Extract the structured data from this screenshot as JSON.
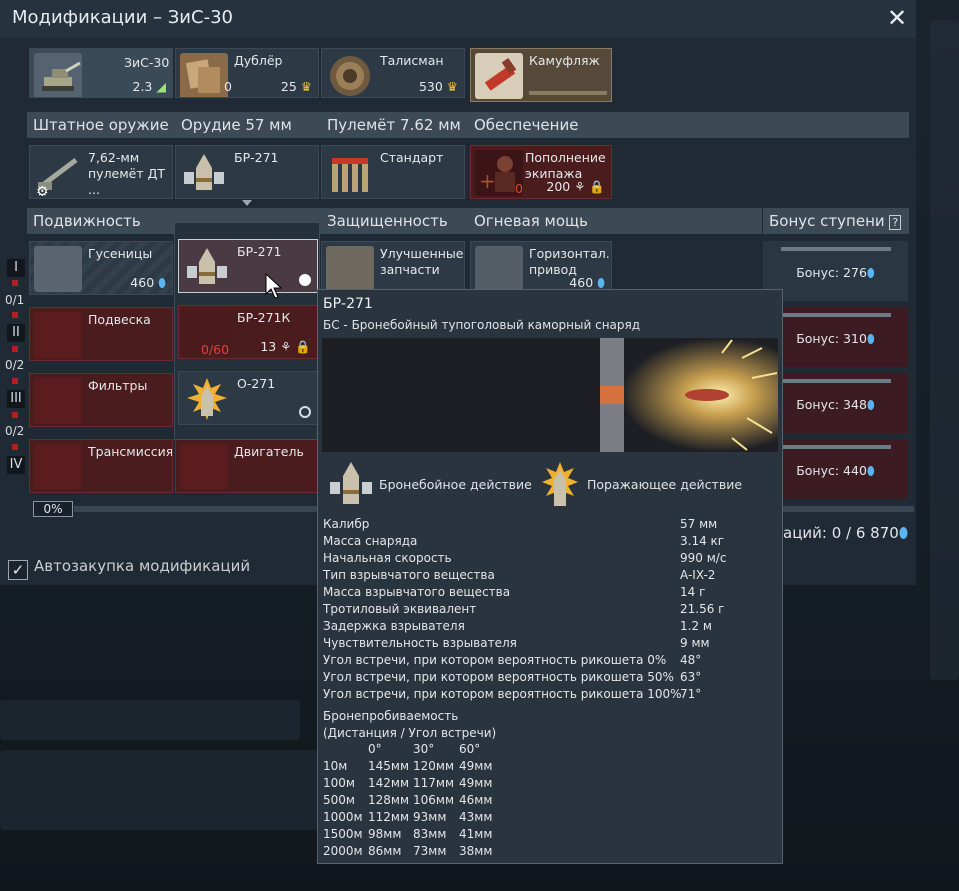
{
  "window": {
    "title": "Модификации – ЗиС-30",
    "close": "✕"
  },
  "top_cards": {
    "vehicle": {
      "name": "ЗиС-30",
      "br": "2.3"
    },
    "backup": {
      "name": "Дублёр",
      "owned": "0",
      "price": "25"
    },
    "talisman": {
      "name": "Талисман",
      "price": "530"
    },
    "camo": {
      "name": "Камуфляж"
    }
  },
  "weapon_headers": [
    "Штатное оружие",
    "Орудие 57 мм",
    "Пулемёт 7.62 мм",
    "Обеспечение"
  ],
  "weapon_cards": {
    "mg": "7,62-мм пулемёт ДТ ...",
    "shell": "БР-271",
    "mgammo": "Стандарт",
    "crew": {
      "name": "Пополнение экипажа",
      "count": "0",
      "price": "200"
    }
  },
  "mod_headers": [
    "Подвижность",
    "Защищенность",
    "Огневая мощь",
    "Бонус ступени"
  ],
  "mobility": [
    {
      "name": "Гусеницы",
      "price": "460"
    },
    {
      "name": "Подвеска"
    },
    {
      "name": "Фильтры"
    },
    {
      "name": "Трансмиссия"
    }
  ],
  "engine": "Двигатель",
  "protection": {
    "name": "Улучшенные запчасти"
  },
  "firepower": {
    "name": "Горизонтал... привод",
    "price": "460"
  },
  "ranks": [
    "I",
    "II",
    "III",
    "IV"
  ],
  "fracs": [
    "0/1",
    "0/2",
    "0/2"
  ],
  "bonuses": [
    "Бонус: 276",
    "Бонус: 310",
    "Бонус: 348",
    "Бонус: 440"
  ],
  "shell_popup": [
    {
      "name": "БР-271"
    },
    {
      "name": "БР-271К",
      "progress": "0/60",
      "price": "13"
    },
    {
      "name": "О-271"
    }
  ],
  "progress": "0%",
  "cost_line": "аций: 0 / 6 870",
  "autobuy": "Автозакупка модификаций",
  "tooltip": {
    "title": "БР-271",
    "subtitle": "БС - Бронебойный тупоголовый каморный снаряд",
    "effect1": "Бронебойное действие",
    "effect2": "Поражающее действие",
    "stats": [
      {
        "k": "Калибр",
        "v": "57 мм"
      },
      {
        "k": "Масса снаряда",
        "v": "3.14 кг"
      },
      {
        "k": "Начальная скорость",
        "v": "990 м/с"
      },
      {
        "k": "Тип взрывчатого вещества",
        "v": "A-IX-2"
      },
      {
        "k": "Масса взрывчатого вещества",
        "v": "14 г"
      },
      {
        "k": "Тротиловый эквивалент",
        "v": "21.56 г"
      },
      {
        "k": "Задержка взрывателя",
        "v": "1.2 м"
      },
      {
        "k": "Чувствительность взрывателя",
        "v": "9 мм"
      },
      {
        "k": "Угол встречи, при котором вероятность рикошета 0%",
        "v": "48°"
      },
      {
        "k": "Угол встречи, при котором вероятность рикошета 50%",
        "v": "63°"
      },
      {
        "k": "Угол встречи, при котором вероятность рикошета 100%",
        "v": "71°"
      }
    ],
    "pen_title": "Бронепробиваемость",
    "pen_sub": "(Дистанция / Угол встречи)",
    "pen_angles": [
      "0°",
      "30°",
      "60°"
    ],
    "pen_rows": [
      {
        "d": "10м",
        "a": "145мм",
        "b": "120мм",
        "c": "49мм"
      },
      {
        "d": "100м",
        "a": "142мм",
        "b": "117мм",
        "c": "49мм"
      },
      {
        "d": "500м",
        "a": "128мм",
        "b": "106мм",
        "c": "46мм"
      },
      {
        "d": "1000м",
        "a": "112мм",
        "b": "93мм",
        "c": "43мм"
      },
      {
        "d": "1500м",
        "a": "98мм",
        "b": "83мм",
        "c": "41мм"
      },
      {
        "d": "2000м",
        "a": "86мм",
        "b": "73мм",
        "c": "38мм"
      }
    ]
  },
  "colors": {
    "accent_red": "#b02020",
    "rp_blue": "#5ab4f0",
    "gold": "#f0c040"
  }
}
